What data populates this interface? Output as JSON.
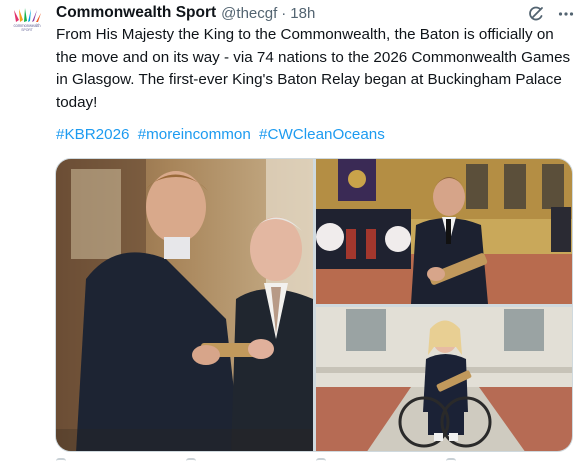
{
  "tweet": {
    "author": {
      "display_name": "Commonwealth Sport",
      "handle": "@thecgf",
      "separator": "·",
      "timestamp": "18h",
      "avatar_logo_text": "commonwealth",
      "avatar_logo_subtext": "SPORT"
    },
    "text": "From His Majesty the King to the Commonwealth, the Baton is officially on the move and on its way - via 74 nations to the 2026 Commonwealth Games in Glasgow. The first-ever King's Baton Relay began at Buckingham Palace today!",
    "hashtags": [
      "#KBR2026",
      "#moreincommon",
      "#CWCleanOceans"
    ],
    "media": {
      "count": 3,
      "photos": [
        {
          "icon": "photo-handshake-baton"
        },
        {
          "icon": "photo-man-holding-baton-palace-band"
        },
        {
          "icon": "photo-wheelchair-athlete-baton"
        }
      ]
    },
    "icons": {
      "grok": "grok-icon",
      "more": "more-icon"
    },
    "colors": {
      "link": "#1d9bf0",
      "text": "#0f1419",
      "secondary": "#536471",
      "border": "#cfd9de"
    }
  }
}
